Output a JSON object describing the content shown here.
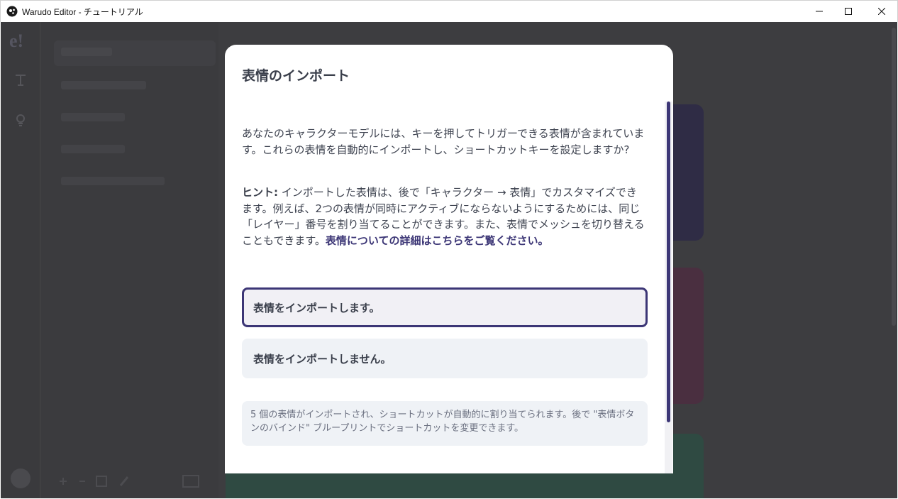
{
  "window": {
    "title": "Warudo Editor - チュートリアル"
  },
  "background": {
    "sidebar_items": [
      "",
      "",
      "",
      "",
      ""
    ]
  },
  "modal": {
    "title": "表情のインポート",
    "intro": "あなたのキャラクターモデルには、キーを押してトリガーできる表情が含まれています。これらの表情を自動的にインポートし、ショートカットキーを設定しますか?",
    "hint_label": "ヒント:",
    "hint_text": " インポートした表情は、後で「キャラクター → 表情」でカスタマイズできます。例えば、2つの表情が同時にアクティブにならないようにするためには、同じ「レイヤー」番号を割り当てることができます。また、表情でメッシュを切り替えることもできます。",
    "hint_link": "表情についての詳細はこちらをご覧ください。",
    "option_import": "表情をインポートします。",
    "option_skip": "表情をインポートしません。",
    "note": "5 個の表情がインポートされ、ショートカットが自動的に割り当てられます。後で \"表情ボタンのバインド\" ブループリントでショートカットを変更できます。"
  },
  "colors": {
    "accent": "#3c3676",
    "option_bg": "#eff2f6",
    "overlay": "#3d3d40"
  }
}
